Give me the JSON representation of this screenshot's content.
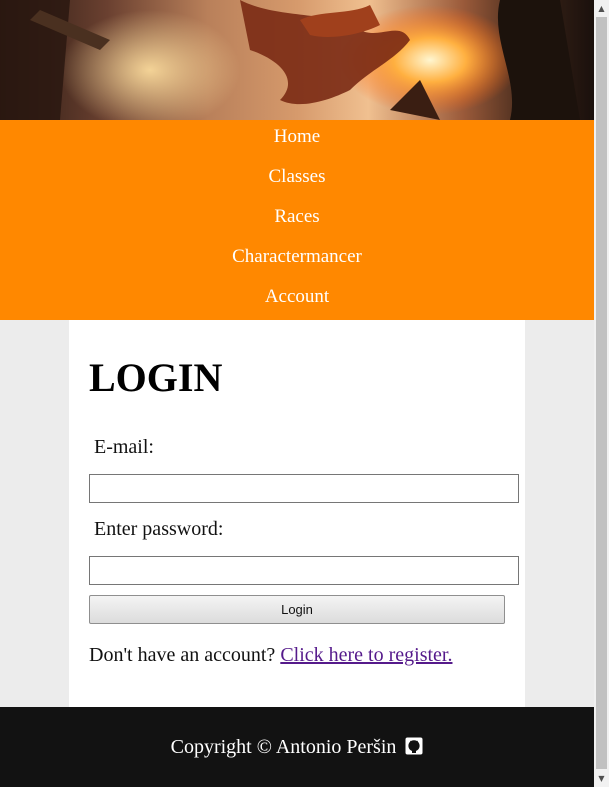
{
  "nav": {
    "items": [
      {
        "label": "Home"
      },
      {
        "label": "Classes"
      },
      {
        "label": "Races"
      },
      {
        "label": "Charactermancer"
      },
      {
        "label": "Account"
      }
    ]
  },
  "login": {
    "title": "LOGIN",
    "email_label": "E-mail:",
    "email_value": "",
    "password_label": "Enter password:",
    "password_value": "",
    "button_label": "Login",
    "register_prompt": "Don't have an account?",
    "register_link": "Click here to register."
  },
  "footer": {
    "copyright": "Copyright © Antonio Peršin",
    "icon": "github-icon"
  },
  "colors": {
    "nav_background": "#ff8800",
    "footer_background": "#121212",
    "link": "#551a8b"
  }
}
